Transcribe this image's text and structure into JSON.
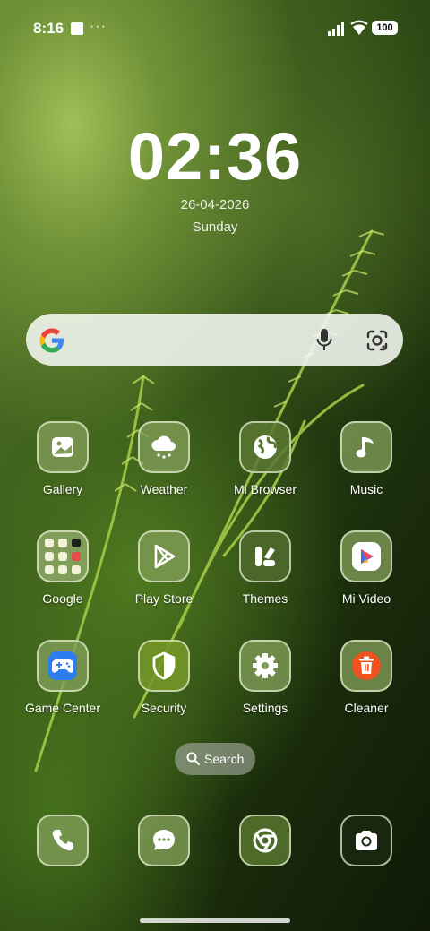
{
  "status_bar": {
    "time": "8:16",
    "overflow": "···",
    "battery": "100",
    "icons": [
      "square-notification-icon",
      "signal-icon",
      "wifi-icon",
      "battery-icon"
    ]
  },
  "lock_clock": {
    "time": "02:36",
    "date": "26-04-2026",
    "day": "Sunday"
  },
  "search_bar": {
    "icons": [
      "google-logo-icon",
      "mic-icon",
      "google-lens-icon"
    ]
  },
  "apps": [
    {
      "label": "Gallery",
      "icon": "gallery-icon"
    },
    {
      "label": "Weather",
      "icon": "weather-icon"
    },
    {
      "label": "Mi Browser",
      "icon": "globe-icon"
    },
    {
      "label": "Music",
      "icon": "music-note-icon"
    },
    {
      "label": "Google",
      "icon": "folder-icon"
    },
    {
      "label": "Play Store",
      "icon": "play-store-icon"
    },
    {
      "label": "Themes",
      "icon": "themes-icon"
    },
    {
      "label": "Mi Video",
      "icon": "video-play-icon"
    },
    {
      "label": "Game Center",
      "icon": "gamepad-icon"
    },
    {
      "label": "Security",
      "icon": "shield-icon"
    },
    {
      "label": "Settings",
      "icon": "gear-icon"
    },
    {
      "label": "Cleaner",
      "icon": "trash-icon"
    }
  ],
  "app_search": {
    "label": "Search"
  },
  "dock": [
    {
      "icon": "phone-icon"
    },
    {
      "icon": "messages-icon"
    },
    {
      "icon": "chrome-icon"
    },
    {
      "icon": "camera-icon"
    }
  ],
  "colors": {
    "tile": "#829e58",
    "tile_border": "#e1ebcd",
    "game_center": "#2d7cf2",
    "cleaner": "#f0521e",
    "mi_video_red": "#f24a5b",
    "mi_video_blue": "#3d6ff5"
  }
}
